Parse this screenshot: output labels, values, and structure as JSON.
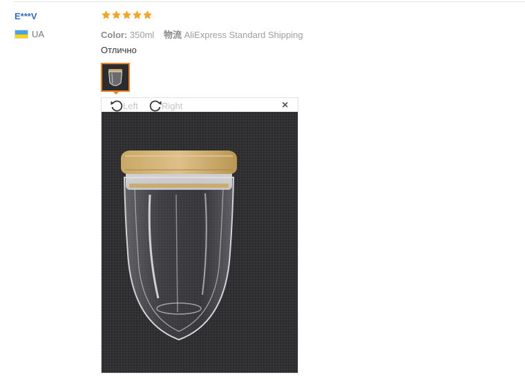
{
  "reviewer": {
    "name": "E***V",
    "country_code": "UA",
    "flag_colors": [
      "#4aa3e8",
      "#ffd500"
    ]
  },
  "feedback": {
    "rating": 5,
    "star_color": "#f5a623",
    "color_label": "Color:",
    "color_value": "350ml",
    "shipping_label": "物流",
    "shipping_value": "AliExpress Standard Shipping",
    "text": "Отлично"
  },
  "viewer": {
    "rotate_left_label": "Left",
    "rotate_right_label": "Right",
    "close_glyph": "×",
    "accent_color": "#f58220"
  }
}
